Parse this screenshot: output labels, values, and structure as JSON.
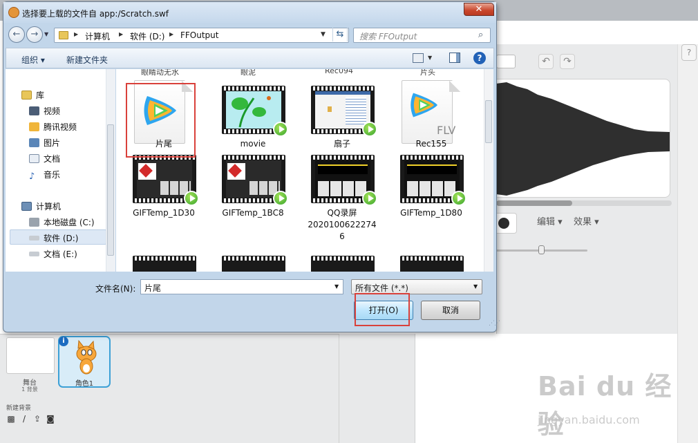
{
  "dialog": {
    "title": "选择要上载的文件自 app:/Scratch.swf",
    "close_glyph": "✕",
    "breadcrumbs": [
      "计算机",
      "软件 (D:)",
      "FFOutput"
    ],
    "search_placeholder": "搜索 FFOutput",
    "toolbar": {
      "organize": "组织 ▾",
      "new_folder": "新建文件夹"
    },
    "nav": {
      "library": "库",
      "videos": "视频",
      "tencent_video": "腾讯视频",
      "pictures": "图片",
      "documents": "文档",
      "music": "音乐",
      "computer": "计算机",
      "local_c": "本地磁盘 (C:)",
      "soft_d": "软件 (D:)",
      "doc_e": "文档 (E:)"
    },
    "cut_labels": [
      "眼睛动无水",
      "眼泥",
      "Rec094",
      "片头"
    ],
    "files": [
      {
        "name": "片尾",
        "kind": "tencent-doc"
      },
      {
        "name": "movie",
        "kind": "video"
      },
      {
        "name": "扇子",
        "kind": "video"
      },
      {
        "name": "Rec155",
        "kind": "flv-doc"
      },
      {
        "name": "GIFTemp_1D30",
        "kind": "video"
      },
      {
        "name": "GIFTemp_1BC8",
        "kind": "video"
      },
      {
        "name": "QQ录屏\n2020100622274\n6",
        "kind": "video"
      },
      {
        "name": "GIFTemp_1D80",
        "kind": "video"
      }
    ],
    "flv_tag": "FLV",
    "filename_label": "文件名(N):",
    "filename_value": "片尾",
    "filetype_value": "所有文件 (*.*)",
    "open_button": "打开(O)",
    "cancel_button": "取消"
  },
  "scratch": {
    "edit_menu": "编辑 ▾",
    "effect_menu": "效果 ▾",
    "help": "?",
    "stage_label": "舞台",
    "stage_count": "1 背景",
    "new_backdrop": "新建背景",
    "sprite_name": "角色1",
    "info_badge": "i"
  },
  "watermark": {
    "text": "Bai du 经验",
    "url": "jingyan.baidu.com"
  },
  "colors": {
    "highlight_red": "#d9403a",
    "accent_blue": "#3ca0d6"
  }
}
